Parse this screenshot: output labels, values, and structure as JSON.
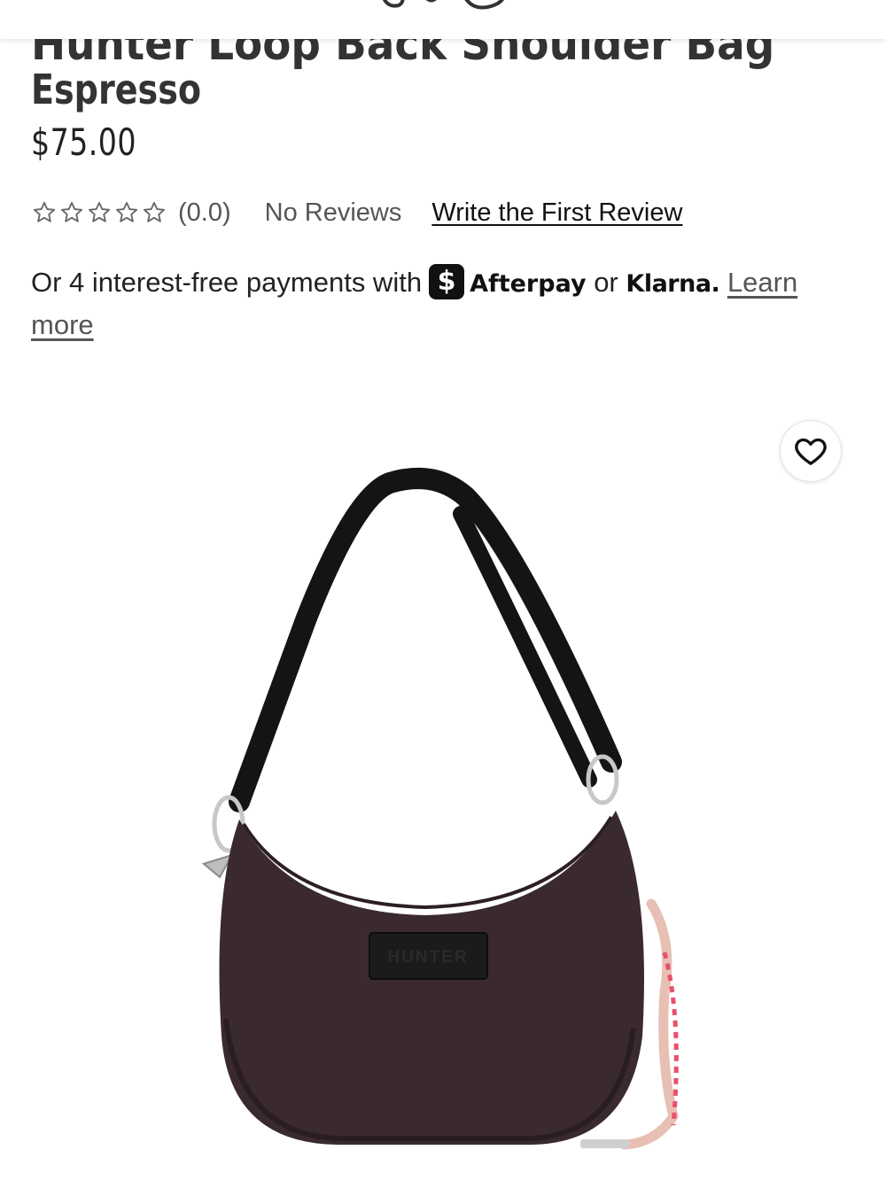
{
  "header": {
    "logo_icon": "brand-logo-icon"
  },
  "product": {
    "title_cut": "Hunter Loop Back Shoulder Bag",
    "title_visible": "Espresso",
    "price": "$75.00",
    "rating_icon": "star-outline-icon",
    "rating_stars_filled": 0,
    "rating_stars_total": 5,
    "rating_value": "(0.0)",
    "review_count_text": "No Reviews",
    "write_review_label": "Write the First Review",
    "brand_patch_text": "HUNTER",
    "color_name": "Espresso",
    "bag_color": "#3a2a2e",
    "strap_color": "#141414"
  },
  "payments": {
    "prefix": "Or 4 interest-free payments with",
    "afterpay_icon": "afterpay-dollar-icon",
    "afterpay_symbol": "$",
    "afterpay": "Afterpay",
    "or": "or",
    "klarna": "Klarna.",
    "learn_more": "Learn more"
  },
  "wishlist": {
    "icon": "heart-outline-icon"
  }
}
